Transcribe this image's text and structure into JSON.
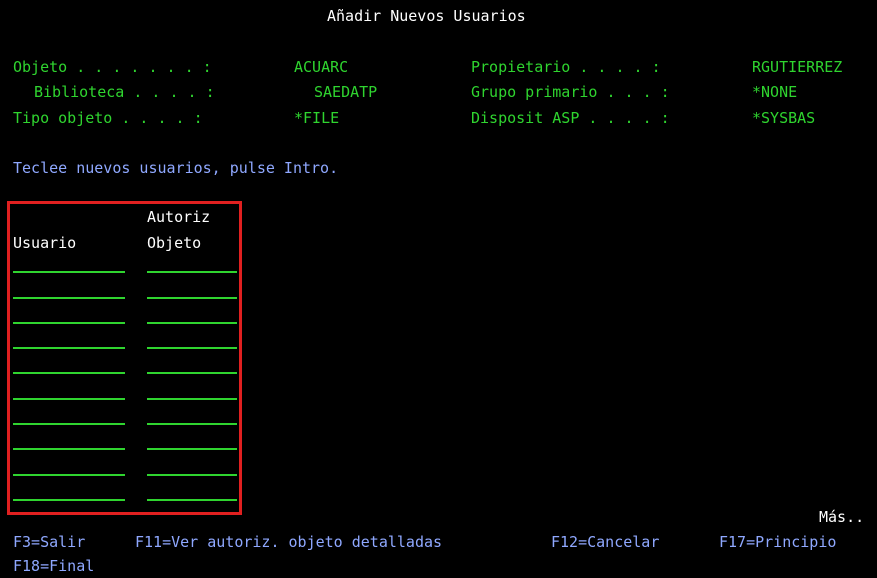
{
  "screen": {
    "title": "Añadir Nuevos Usuarios",
    "more": "Más.."
  },
  "info": {
    "objeto_label": "Objeto . . . . . . . :",
    "objeto_value": "ACUARC",
    "biblioteca_label": "Biblioteca . . . . :",
    "biblioteca_value": "SAEDATP",
    "tipo_label": "Tipo objeto . . . . :",
    "tipo_value": "*FILE",
    "propietario_label": "Propietario . . . . :",
    "propietario_value": "RGUTIERREZ",
    "grupo_label": "Grupo primario . . . :",
    "grupo_value": "*NONE",
    "asp_label": "Disposit ASP . . . . :",
    "asp_value": "*SYSBAS"
  },
  "instruction": "Teclee nuevos usuarios, pulse Intro.",
  "table": {
    "col1_header": "Usuario",
    "col2_header_line1": "Autoriz",
    "col2_header_line2": "Objeto",
    "rows": 10
  },
  "fkeys": {
    "f3": "F3=Salir",
    "f11": "F11=Ver autoriz. objeto detalladas",
    "f12": "F12=Cancelar",
    "f17": "F17=Principio",
    "f18": "F18=Final"
  },
  "colors": {
    "background": "#000000",
    "text_white": "#ffffff",
    "text_green": "#2fd42f",
    "text_blue": "#8fa8ff",
    "highlight_box": "#e02020"
  }
}
